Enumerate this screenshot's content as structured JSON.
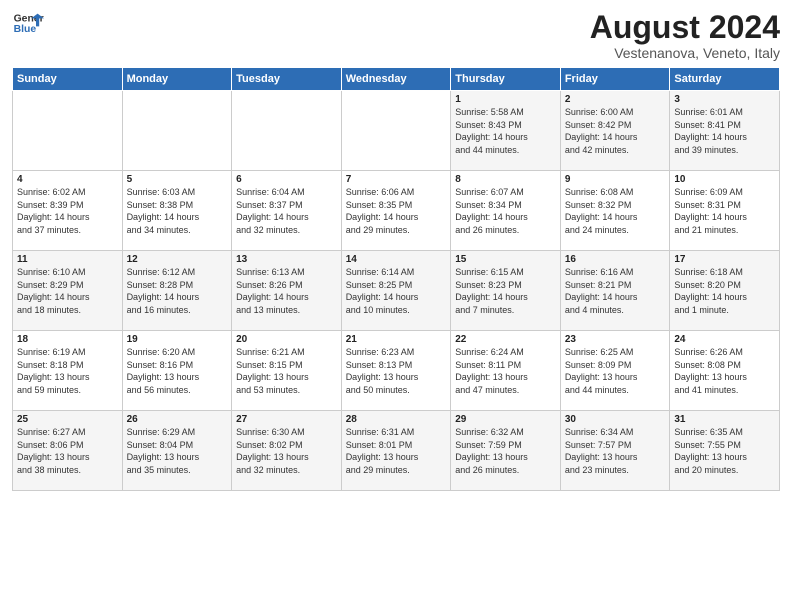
{
  "header": {
    "logo_line1": "General",
    "logo_line2": "Blue",
    "month_year": "August 2024",
    "location": "Vestenanova, Veneto, Italy"
  },
  "weekdays": [
    "Sunday",
    "Monday",
    "Tuesday",
    "Wednesday",
    "Thursday",
    "Friday",
    "Saturday"
  ],
  "weeks": [
    [
      {
        "day": "",
        "text": ""
      },
      {
        "day": "",
        "text": ""
      },
      {
        "day": "",
        "text": ""
      },
      {
        "day": "",
        "text": ""
      },
      {
        "day": "1",
        "text": "Sunrise: 5:58 AM\nSunset: 8:43 PM\nDaylight: 14 hours\nand 44 minutes."
      },
      {
        "day": "2",
        "text": "Sunrise: 6:00 AM\nSunset: 8:42 PM\nDaylight: 14 hours\nand 42 minutes."
      },
      {
        "day": "3",
        "text": "Sunrise: 6:01 AM\nSunset: 8:41 PM\nDaylight: 14 hours\nand 39 minutes."
      }
    ],
    [
      {
        "day": "4",
        "text": "Sunrise: 6:02 AM\nSunset: 8:39 PM\nDaylight: 14 hours\nand 37 minutes."
      },
      {
        "day": "5",
        "text": "Sunrise: 6:03 AM\nSunset: 8:38 PM\nDaylight: 14 hours\nand 34 minutes."
      },
      {
        "day": "6",
        "text": "Sunrise: 6:04 AM\nSunset: 8:37 PM\nDaylight: 14 hours\nand 32 minutes."
      },
      {
        "day": "7",
        "text": "Sunrise: 6:06 AM\nSunset: 8:35 PM\nDaylight: 14 hours\nand 29 minutes."
      },
      {
        "day": "8",
        "text": "Sunrise: 6:07 AM\nSunset: 8:34 PM\nDaylight: 14 hours\nand 26 minutes."
      },
      {
        "day": "9",
        "text": "Sunrise: 6:08 AM\nSunset: 8:32 PM\nDaylight: 14 hours\nand 24 minutes."
      },
      {
        "day": "10",
        "text": "Sunrise: 6:09 AM\nSunset: 8:31 PM\nDaylight: 14 hours\nand 21 minutes."
      }
    ],
    [
      {
        "day": "11",
        "text": "Sunrise: 6:10 AM\nSunset: 8:29 PM\nDaylight: 14 hours\nand 18 minutes."
      },
      {
        "day": "12",
        "text": "Sunrise: 6:12 AM\nSunset: 8:28 PM\nDaylight: 14 hours\nand 16 minutes."
      },
      {
        "day": "13",
        "text": "Sunrise: 6:13 AM\nSunset: 8:26 PM\nDaylight: 14 hours\nand 13 minutes."
      },
      {
        "day": "14",
        "text": "Sunrise: 6:14 AM\nSunset: 8:25 PM\nDaylight: 14 hours\nand 10 minutes."
      },
      {
        "day": "15",
        "text": "Sunrise: 6:15 AM\nSunset: 8:23 PM\nDaylight: 14 hours\nand 7 minutes."
      },
      {
        "day": "16",
        "text": "Sunrise: 6:16 AM\nSunset: 8:21 PM\nDaylight: 14 hours\nand 4 minutes."
      },
      {
        "day": "17",
        "text": "Sunrise: 6:18 AM\nSunset: 8:20 PM\nDaylight: 14 hours\nand 1 minute."
      }
    ],
    [
      {
        "day": "18",
        "text": "Sunrise: 6:19 AM\nSunset: 8:18 PM\nDaylight: 13 hours\nand 59 minutes."
      },
      {
        "day": "19",
        "text": "Sunrise: 6:20 AM\nSunset: 8:16 PM\nDaylight: 13 hours\nand 56 minutes."
      },
      {
        "day": "20",
        "text": "Sunrise: 6:21 AM\nSunset: 8:15 PM\nDaylight: 13 hours\nand 53 minutes."
      },
      {
        "day": "21",
        "text": "Sunrise: 6:23 AM\nSunset: 8:13 PM\nDaylight: 13 hours\nand 50 minutes."
      },
      {
        "day": "22",
        "text": "Sunrise: 6:24 AM\nSunset: 8:11 PM\nDaylight: 13 hours\nand 47 minutes."
      },
      {
        "day": "23",
        "text": "Sunrise: 6:25 AM\nSunset: 8:09 PM\nDaylight: 13 hours\nand 44 minutes."
      },
      {
        "day": "24",
        "text": "Sunrise: 6:26 AM\nSunset: 8:08 PM\nDaylight: 13 hours\nand 41 minutes."
      }
    ],
    [
      {
        "day": "25",
        "text": "Sunrise: 6:27 AM\nSunset: 8:06 PM\nDaylight: 13 hours\nand 38 minutes."
      },
      {
        "day": "26",
        "text": "Sunrise: 6:29 AM\nSunset: 8:04 PM\nDaylight: 13 hours\nand 35 minutes."
      },
      {
        "day": "27",
        "text": "Sunrise: 6:30 AM\nSunset: 8:02 PM\nDaylight: 13 hours\nand 32 minutes."
      },
      {
        "day": "28",
        "text": "Sunrise: 6:31 AM\nSunset: 8:01 PM\nDaylight: 13 hours\nand 29 minutes."
      },
      {
        "day": "29",
        "text": "Sunrise: 6:32 AM\nSunset: 7:59 PM\nDaylight: 13 hours\nand 26 minutes."
      },
      {
        "day": "30",
        "text": "Sunrise: 6:34 AM\nSunset: 7:57 PM\nDaylight: 13 hours\nand 23 minutes."
      },
      {
        "day": "31",
        "text": "Sunrise: 6:35 AM\nSunset: 7:55 PM\nDaylight: 13 hours\nand 20 minutes."
      }
    ]
  ]
}
